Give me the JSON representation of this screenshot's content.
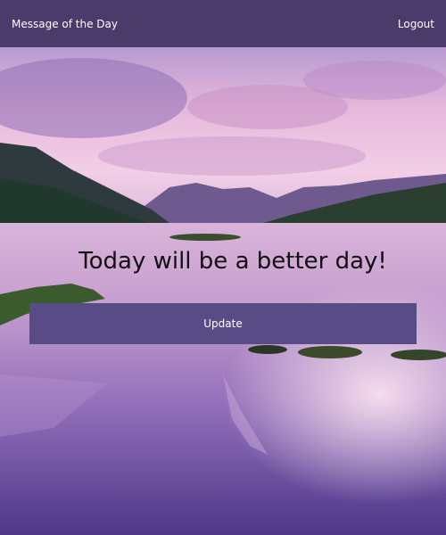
{
  "navbar": {
    "brand_label": "Message of the Day",
    "logout_label": "Logout",
    "background_color": "#4a3b6b"
  },
  "main": {
    "message_text": "Today will be a better day!",
    "update_button_label": "Update",
    "update_button_color": "#574c86"
  },
  "background": {
    "image_description_icon": "landscape-lake-sunset-image"
  }
}
